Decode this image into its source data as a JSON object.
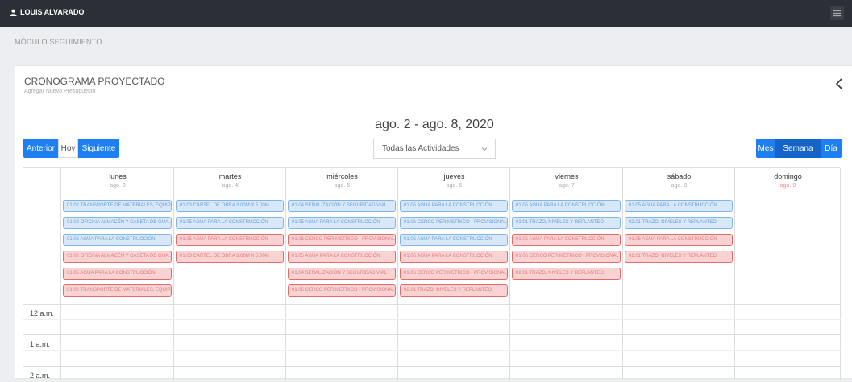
{
  "topbar": {
    "user_name": "LOUIS ALVARADO"
  },
  "module": {
    "title": "MÓDULO SEGUIMIENTO"
  },
  "panel": {
    "title": "CRONOGRAMA PROYECTADO",
    "subtitle": "Agregar Nuevo Presupuesto"
  },
  "calendar": {
    "range_title": "ago. 2 - ago. 8, 2020",
    "prev_label": "Anterior",
    "today_label": "Hoy",
    "next_label": "Siguiente",
    "filter_value": "Todas las Actividades",
    "view_month": "Mes",
    "view_week": "Semana",
    "view_day": "Día",
    "days": [
      {
        "name": "lunes",
        "date": "ago. 3"
      },
      {
        "name": "martes",
        "date": "ago. 4"
      },
      {
        "name": "miércoles",
        "date": "ago. 5"
      },
      {
        "name": "jueves",
        "date": "ago. 6"
      },
      {
        "name": "viernes",
        "date": "ago. 7"
      },
      {
        "name": "sábado",
        "date": "ago. 8"
      },
      {
        "name": "domingo",
        "date": "ago. 9"
      }
    ],
    "events": [
      [
        {
          "label": "01.02 TRANSPORTE DE MATERIALES, EQUIP...",
          "color": "blue"
        },
        {
          "label": "01.02 OFICINA ALMACÉN Y CASETA DE GUA...",
          "color": "blue"
        },
        {
          "label": "01.05 AGUA PARA LA CONSTRUCCIÓN",
          "color": "blue"
        },
        {
          "label": "01.02 OFICINA ALMACÉN Y CASETA DE GUA...",
          "color": "red"
        },
        {
          "label": "01.05 AGUA PARA LA CONSTRUCCIÓN",
          "color": "red"
        },
        {
          "label": "01.02 TRANSPORTE DE MATERIALES, EQUIP...",
          "color": "red"
        }
      ],
      [
        {
          "label": "01.03 CARTEL DE OBRA 3.00M X 5.00M",
          "color": "blue"
        },
        {
          "label": "01.05 AGUA PARA LA CONSTRUCCIÓN",
          "color": "blue"
        },
        {
          "label": "01.05 AGUA PARA LA CONSTRUCCIÓN",
          "color": "red"
        },
        {
          "label": "01.03 CARTEL DE OBRA 3.00M X 5.00M",
          "color": "red"
        }
      ],
      [
        {
          "label": "01.04 SEÑALIZACIÓN Y SEGURIDAD VIAL",
          "color": "blue"
        },
        {
          "label": "01.05 AGUA PARA LA CONSTRUCCIÓN",
          "color": "blue"
        },
        {
          "label": "01.06 CERCO PERIMETRICO - PROVISIONAL",
          "color": "red"
        },
        {
          "label": "01.05 AGUA PARA LA CONSTRUCCIÓN",
          "color": "red"
        },
        {
          "label": "01.04 SEÑALIZACIÓN Y SEGURIDAD VIAL",
          "color": "red"
        },
        {
          "label": "01.06 CERCO PERIMETRICO - PROVISIONAL",
          "color": "red"
        }
      ],
      [
        {
          "label": "01.05 AGUA PARA LA CONSTRUCCIÓN",
          "color": "blue"
        },
        {
          "label": "01.06 CERCO PERIMETRICO - PROVISIONAL",
          "color": "blue"
        },
        {
          "label": "01.05 AGUA PARA LA CONSTRUCCIÓN",
          "color": "blue"
        },
        {
          "label": "01.05 AGUA PARA LA CONSTRUCCIÓN",
          "color": "red"
        },
        {
          "label": "01.06 CERCO PERIMETRICO - PROVISIONAL",
          "color": "red"
        },
        {
          "label": "02.01 TRAZO, NIVELES Y REPLANTEO",
          "color": "red"
        }
      ],
      [
        {
          "label": "01.05 AGUA PARA LA CONSTRUCCIÓN",
          "color": "blue"
        },
        {
          "label": "02.01 TRAZO, NIVELES Y REPLANTEO",
          "color": "blue"
        },
        {
          "label": "01.05 AGUA PARA LA CONSTRUCCIÓN",
          "color": "red"
        },
        {
          "label": "01.06 CERCO PERIMETRICO - PROVISIONAL",
          "color": "red"
        },
        {
          "label": "02.01 TRAZO, NIVELES Y REPLANTEO",
          "color": "red"
        }
      ],
      [
        {
          "label": "01.05 AGUA PARA LA CONSTRUCCIÓN",
          "color": "blue"
        },
        {
          "label": "02.01 TRAZO, NIVELES Y REPLANTEO",
          "color": "blue"
        },
        {
          "label": "01.05 AGUA PARA LA CONSTRUCCIÓN",
          "color": "red"
        },
        {
          "label": "02.01 TRAZO, NIVELES Y REPLANTEO",
          "color": "red"
        }
      ],
      []
    ],
    "times": [
      "12 a.m.",
      "1 a.m.",
      "2 a.m."
    ]
  },
  "colors": {
    "topbar": "#2c2f36",
    "accent_blue": "#1e7ff2",
    "event_blue_border": "#7fb5ea",
    "event_red_border": "#e56a6a",
    "today_date": "#f08a8a"
  },
  "icons": {
    "user": "user-icon",
    "menu": "hamburger-icon",
    "back": "chevron-left-icon",
    "select": "chevron-down-icon"
  }
}
